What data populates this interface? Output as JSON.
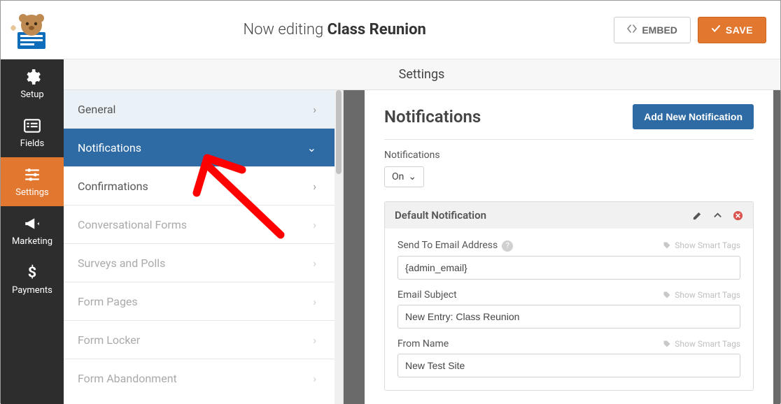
{
  "header": {
    "editing_prefix": "Now editing ",
    "editing_title": "Class Reunion",
    "embed_label": "EMBED",
    "save_label": "SAVE"
  },
  "iconbar": {
    "setup": "Setup",
    "fields": "Fields",
    "settings": "Settings",
    "marketing": "Marketing",
    "payments": "Payments"
  },
  "subheader": "Settings",
  "settings_list": {
    "general": "General",
    "notifications": "Notifications",
    "confirmations": "Confirmations",
    "conversational": "Conversational Forms",
    "surveys": "Surveys and Polls",
    "form_pages": "Form Pages",
    "form_locker": "Form Locker",
    "form_abandonment": "Form Abandonment"
  },
  "main": {
    "title": "Notifications",
    "add_new": "Add New Notification",
    "toggle_label": "Notifications",
    "toggle_value": "On",
    "card_title": "Default Notification",
    "smart_tags": "Show Smart Tags",
    "fields": {
      "send_to_label": "Send To Email Address",
      "send_to_value": "{admin_email}",
      "subject_label": "Email Subject",
      "subject_value": "New Entry: Class Reunion",
      "from_name_label": "From Name",
      "from_name_value": "New Test Site"
    }
  }
}
